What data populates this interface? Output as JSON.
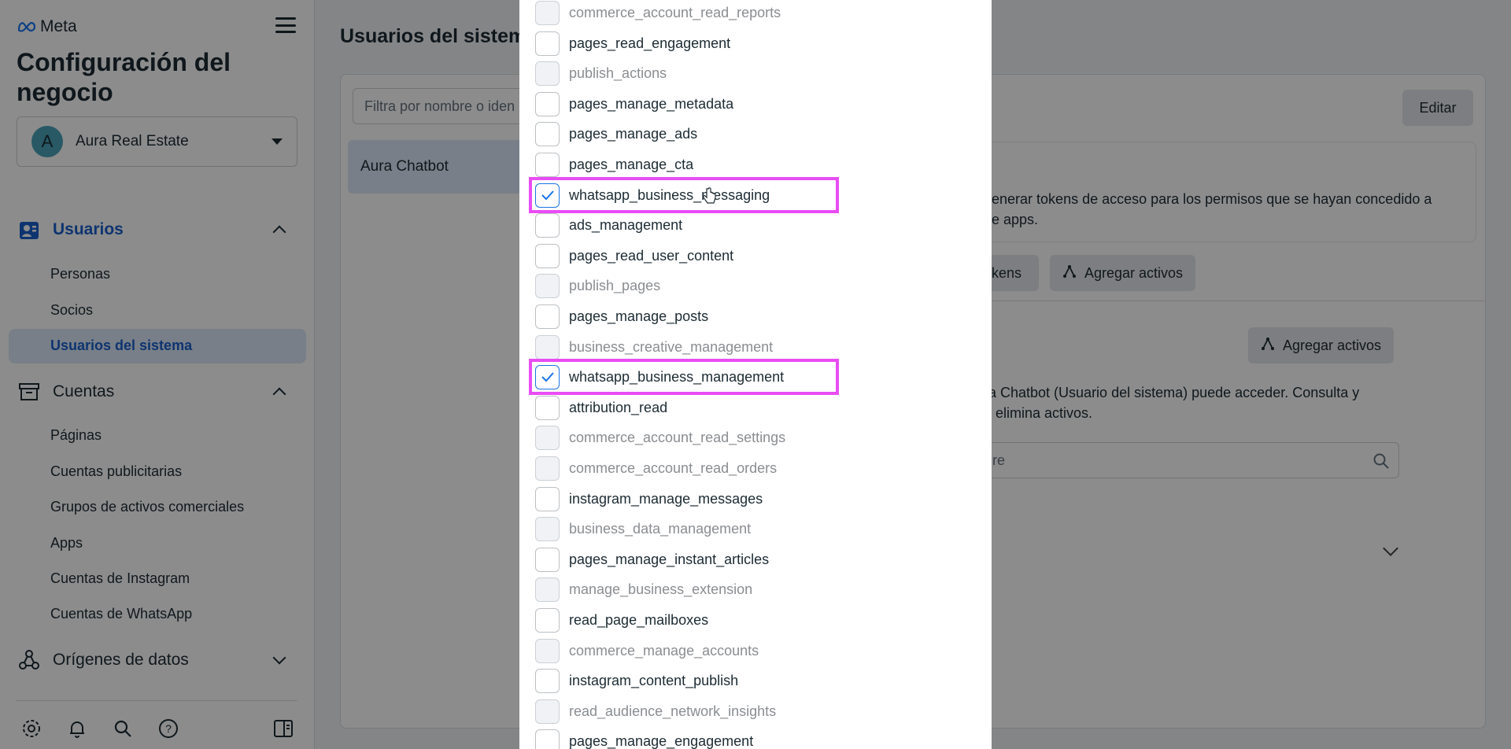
{
  "sidebar": {
    "logo_text": "Meta",
    "heading": "Configuración del negocio",
    "business": {
      "avatar_letter": "A",
      "name": "Aura Real Estate"
    },
    "sections": [
      {
        "label": "Usuarios",
        "icon": "users-icon",
        "expanded": true,
        "active": true,
        "items": [
          {
            "label": "Personas"
          },
          {
            "label": "Socios"
          },
          {
            "label": "Usuarios del sistema",
            "active": true
          }
        ]
      },
      {
        "label": "Cuentas",
        "icon": "archive-icon",
        "expanded": true,
        "items": [
          {
            "label": "Páginas"
          },
          {
            "label": "Cuentas publicitarias"
          },
          {
            "label": "Grupos de activos comerciales"
          },
          {
            "label": "Apps"
          },
          {
            "label": "Cuentas de Instagram"
          },
          {
            "label": "Cuentas de WhatsApp"
          }
        ]
      },
      {
        "label": "Orígenes de datos",
        "icon": "data-sources-icon",
        "expanded": false
      }
    ],
    "footer_icons": [
      "settings-icon",
      "bell-icon",
      "search-icon",
      "help-icon"
    ]
  },
  "main": {
    "title": "Usuarios del sistem",
    "filter_placeholder": "Filtra por nombre o iden",
    "selected_user": "Aura Chatbot",
    "edit_label": "Editar",
    "info_text_1": "generar tokens de acceso para los permisos que se hayan concedido a",
    "info_text_2": "de apps.",
    "tokens_label": "kens",
    "add_assets_label": "Agregar activos",
    "add_assets_label_2": "Agregar activos",
    "assets_text_1": "ra Chatbot (Usuario del sistema) puede acceder. Consulta y",
    "assets_text_2": "o elimina activos.",
    "search_text": "re"
  },
  "modal": {
    "permissions": [
      {
        "label": "commerce_account_read_reports",
        "disabled": true,
        "checked": false
      },
      {
        "label": "pages_read_engagement",
        "disabled": false,
        "checked": false
      },
      {
        "label": "publish_actions",
        "disabled": true,
        "checked": false
      },
      {
        "label": "pages_manage_metadata",
        "disabled": false,
        "checked": false
      },
      {
        "label": "pages_manage_ads",
        "disabled": false,
        "checked": false
      },
      {
        "label": "pages_manage_cta",
        "disabled": false,
        "checked": false
      },
      {
        "label": "whatsapp_business_messaging",
        "disabled": false,
        "checked": true,
        "highlighted": true
      },
      {
        "label": "ads_management",
        "disabled": false,
        "checked": false
      },
      {
        "label": "pages_read_user_content",
        "disabled": false,
        "checked": false
      },
      {
        "label": "publish_pages",
        "disabled": true,
        "checked": false
      },
      {
        "label": "pages_manage_posts",
        "disabled": false,
        "checked": false
      },
      {
        "label": "business_creative_management",
        "disabled": true,
        "checked": false
      },
      {
        "label": "whatsapp_business_management",
        "disabled": false,
        "checked": true,
        "highlighted": true
      },
      {
        "label": "attribution_read",
        "disabled": false,
        "checked": false
      },
      {
        "label": "commerce_account_read_settings",
        "disabled": true,
        "checked": false
      },
      {
        "label": "commerce_account_read_orders",
        "disabled": true,
        "checked": false
      },
      {
        "label": "instagram_manage_messages",
        "disabled": false,
        "checked": false
      },
      {
        "label": "business_data_management",
        "disabled": true,
        "checked": false
      },
      {
        "label": "pages_manage_instant_articles",
        "disabled": false,
        "checked": false
      },
      {
        "label": "manage_business_extension",
        "disabled": true,
        "checked": false
      },
      {
        "label": "read_page_mailboxes",
        "disabled": false,
        "checked": false
      },
      {
        "label": "commerce_manage_accounts",
        "disabled": true,
        "checked": false
      },
      {
        "label": "instagram_content_publish",
        "disabled": false,
        "checked": false
      },
      {
        "label": "read_audience_network_insights",
        "disabled": true,
        "checked": false
      },
      {
        "label": "pages_manage_engagement",
        "disabled": false,
        "checked": false
      }
    ]
  },
  "colors": {
    "accent": "#1b5fcc",
    "highlight": "#e94cf5",
    "checkbox_check": "#1b74e4"
  }
}
